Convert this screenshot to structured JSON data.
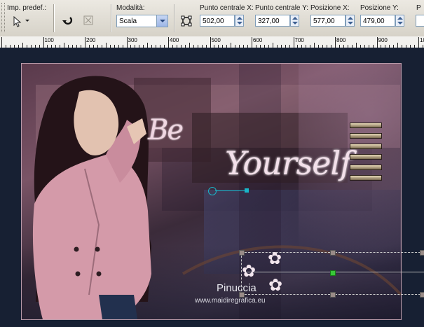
{
  "toolbar": {
    "preset_label": "Imp. predef.:",
    "mode_label": "Modalità:",
    "mode_value": "Scala",
    "center_x_label": "Punto centrale X:",
    "center_x_value": "502,00",
    "center_y_label": "Punto centrale Y:",
    "center_y_value": "327,00",
    "pos_x_label": "Posizione X:",
    "pos_x_value": "577,00",
    "pos_y_label": "Posizione Y:",
    "pos_y_value": "479,00",
    "extra_label": "P"
  },
  "ruler": {
    "marks": [
      "100",
      "200",
      "300",
      "400",
      "500",
      "600",
      "700",
      "800",
      "900",
      "1000"
    ]
  },
  "artwork": {
    "title_be": "Be",
    "title_yourself": "Yourself",
    "signature": "Pinuccia",
    "website": "www.maidiregrafica.eu"
  },
  "icons": {
    "preset": "pointer-arrow-icon",
    "reset": "undo-rotate-icon",
    "disabled": "crossed-square-icon",
    "mode_tool": "transform-box-icon"
  },
  "colors": {
    "toolbar": "#d6d2c8",
    "canvas_bg": "#172033",
    "accent_cyan": "#19b5c8",
    "coat_pink": "#d49aa9"
  }
}
